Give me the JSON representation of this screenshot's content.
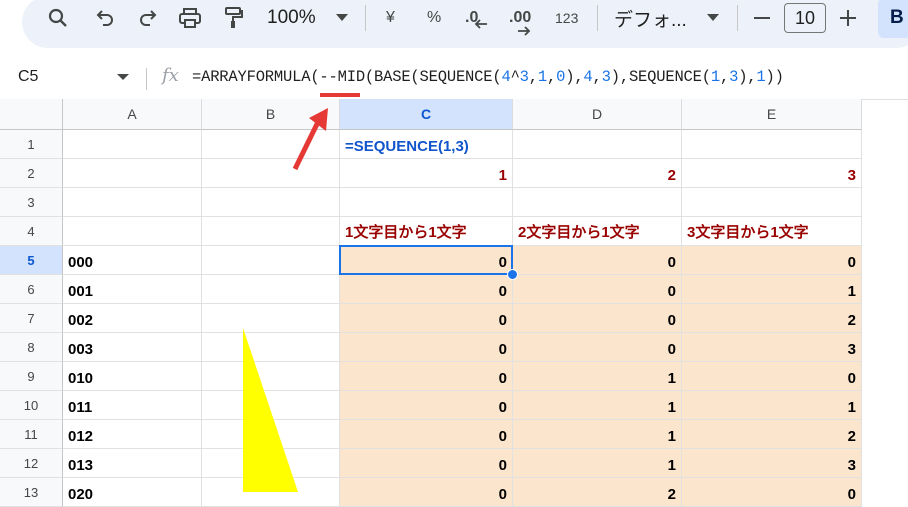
{
  "toolbar": {
    "zoom": "100%",
    "currency_symbol": "¥",
    "percent_symbol": "%",
    "decrease_decimals": ".0",
    "increase_decimals": ".00",
    "more_formats": "123",
    "font_name": "デフォ...",
    "font_size": "10",
    "bold_label": "B"
  },
  "formula_bar": {
    "name_box": "C5",
    "fx": "fx",
    "formula_parts": [
      {
        "t": "=ARRAYFORMULA(--MID(BASE(SEQUENCE(",
        "num": false
      },
      {
        "t": "4",
        "num": true
      },
      {
        "t": "^",
        "num": false
      },
      {
        "t": "3",
        "num": true
      },
      {
        "t": ",",
        "num": false
      },
      {
        "t": "1",
        "num": true
      },
      {
        "t": ",",
        "num": false
      },
      {
        "t": "0",
        "num": true
      },
      {
        "t": "),",
        "num": false
      },
      {
        "t": "4",
        "num": true
      },
      {
        "t": ",",
        "num": false
      },
      {
        "t": "3",
        "num": true
      },
      {
        "t": "),SEQUENCE(",
        "num": false
      },
      {
        "t": "1",
        "num": true
      },
      {
        "t": ",",
        "num": false
      },
      {
        "t": "3",
        "num": true
      },
      {
        "t": "),",
        "num": false
      },
      {
        "t": "1",
        "num": true
      },
      {
        "t": "))",
        "num": false
      }
    ]
  },
  "columns": [
    "A",
    "B",
    "C",
    "D",
    "E"
  ],
  "selected_column": "C",
  "rows": [
    "1",
    "2",
    "3",
    "4",
    "5",
    "6",
    "7",
    "8",
    "9",
    "10",
    "11",
    "12",
    "13"
  ],
  "selected_row": "5",
  "cells": {
    "C1": "=SEQUENCE(1,3)",
    "C2": "1",
    "D2": "2",
    "E2": "3",
    "C4": "1文字目から1文字",
    "D4": "2文字目から1文字",
    "E4": "3文字目から1文字",
    "A5": "000",
    "A6": "001",
    "A7": "002",
    "A8": "003",
    "A9": "010",
    "A10": "011",
    "A11": "012",
    "A12": "013",
    "A13": "020",
    "C5": "0",
    "D5": "0",
    "E5": "0",
    "C6": "0",
    "D6": "0",
    "E6": "1",
    "C7": "0",
    "D7": "0",
    "E7": "2",
    "C8": "0",
    "D8": "0",
    "E8": "3",
    "C9": "0",
    "D9": "1",
    "E9": "0",
    "C10": "0",
    "D10": "1",
    "E10": "1",
    "C11": "0",
    "D11": "1",
    "E11": "2",
    "C12": "0",
    "D12": "1",
    "E12": "3",
    "C13": "0",
    "D13": "2",
    "E13": "0"
  },
  "annotation_colors": {
    "underline": "#e53935",
    "arrow": "#e53935",
    "triangle": "#ffff00",
    "result_fill": "#fce5cd",
    "header_text": "#990000"
  }
}
